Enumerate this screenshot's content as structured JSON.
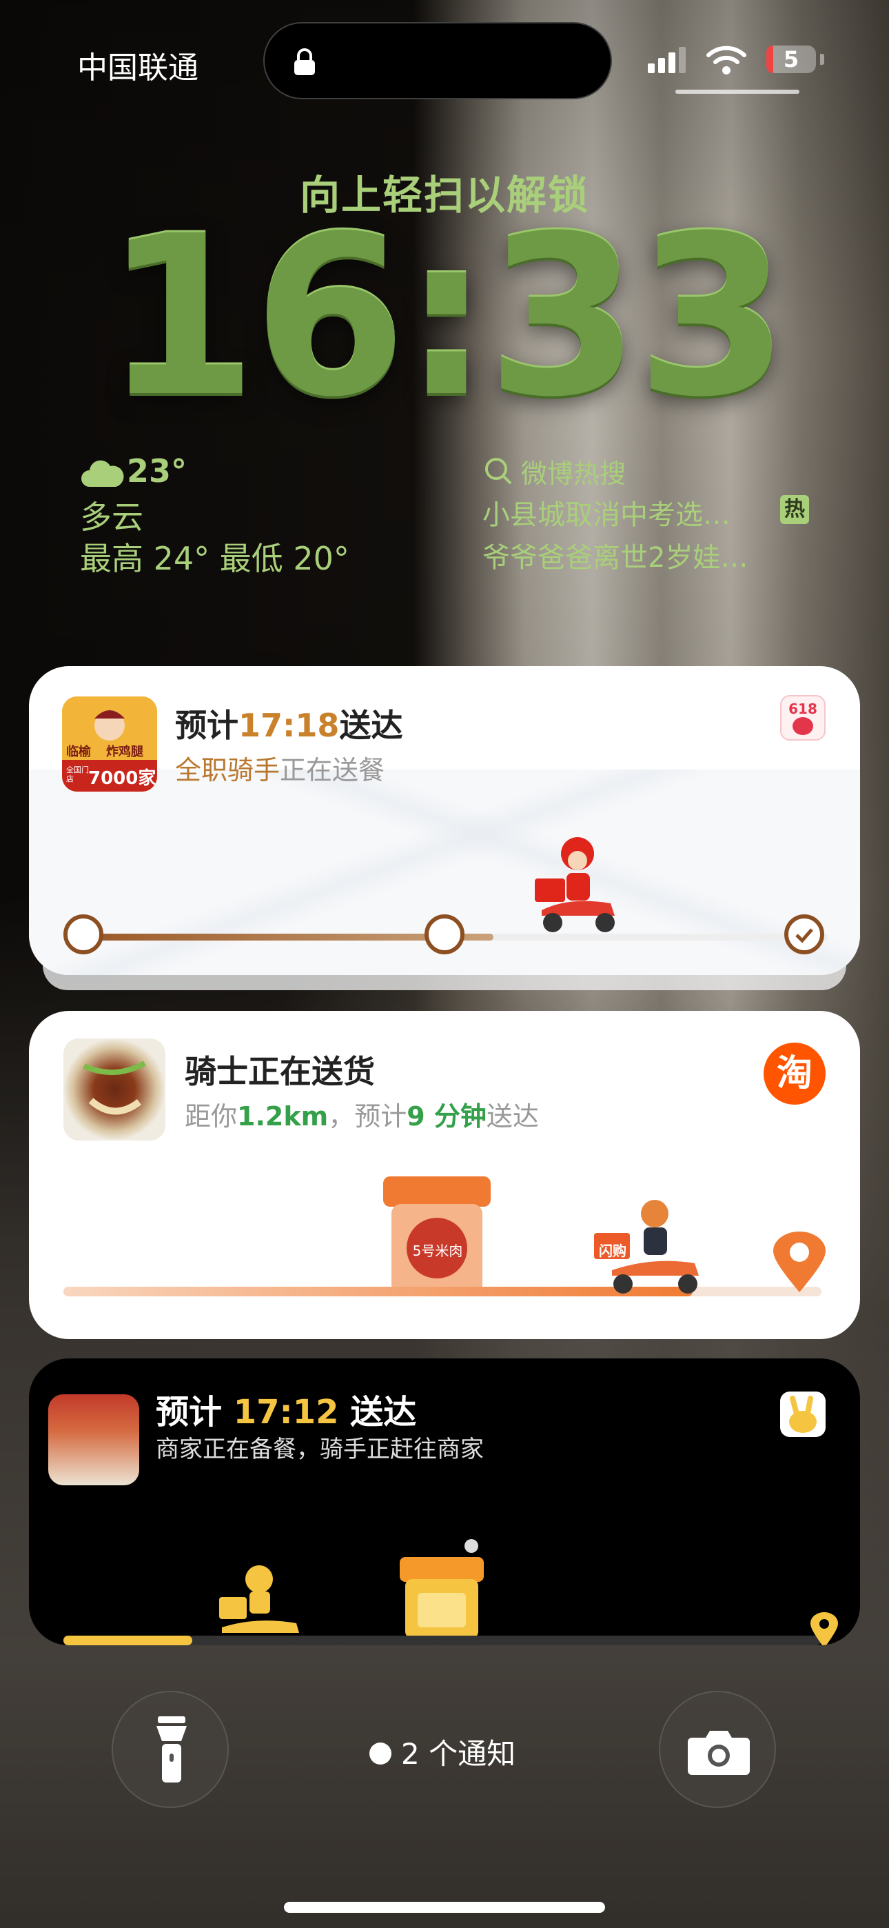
{
  "status_bar": {
    "carrier": "中国联通",
    "battery_level": "5"
  },
  "lock": {
    "unlock_hint": "向上轻扫以解锁",
    "time": "16:33"
  },
  "weather": {
    "icon": "cloud-icon",
    "temperature": "23°",
    "condition": "多云",
    "range": "最高 24° 最低 20°"
  },
  "weibo_hot": {
    "icon": "search-icon",
    "title": "微博热搜",
    "items": [
      "小县城取消中考选…",
      "爷爷爸爸离世2岁娃…"
    ],
    "badge": "热"
  },
  "cards": [
    {
      "app": "meituan",
      "title_prefix": "预计",
      "title_time": "17:18",
      "title_suffix": "送达",
      "sub_highlight": "全职骑手",
      "sub_rest": "正在送餐",
      "shop_image_text": [
        "临榆",
        "炸鸡腿",
        "全国门店",
        "7000家"
      ],
      "app_badge_text": "618",
      "progress": 0.55,
      "accent": "#c9822b"
    },
    {
      "app": "taobao",
      "title": "骑士正在送货",
      "sub_prefix": "距你",
      "distance": "1.2km",
      "sub_mid": "，预计",
      "minutes": "9 分钟",
      "sub_suffix": "送达",
      "app_badge_text": "淘",
      "store_label": "5号米肉",
      "scooter_box_label": "闪购",
      "progress": 0.83,
      "accent": "#f07a32"
    },
    {
      "app": "eleme",
      "title_prefix": "预计",
      "title_time": "17:12",
      "title_suffix": "送达",
      "sub": "商家正在备餐，骑手正赶往商家",
      "progress": 0.17,
      "accent": "#f5c542"
    }
  ],
  "bottom": {
    "notifications": "2 个通知",
    "flashlight_icon": "flashlight-icon",
    "camera_icon": "camera-icon"
  }
}
